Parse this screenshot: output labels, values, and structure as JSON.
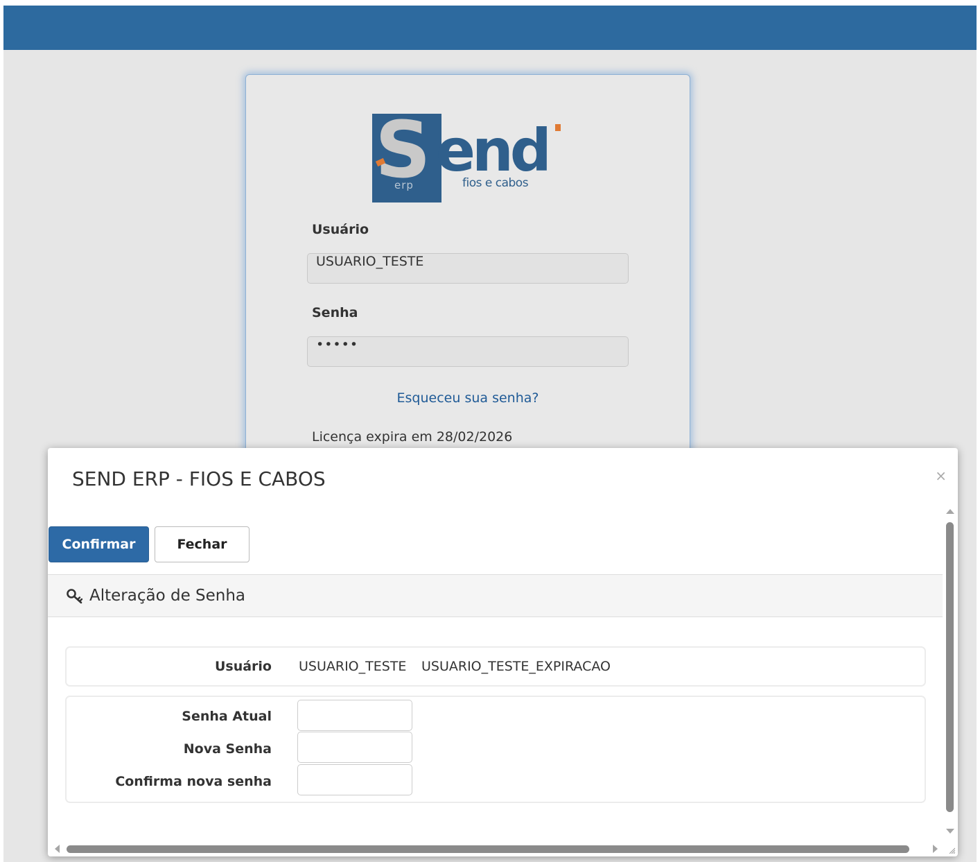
{
  "login": {
    "logo": {
      "s_letter": "S",
      "end_text": "end",
      "erp_text": "erp",
      "subtitle": "fios e cabos"
    },
    "user_label": "Usuário",
    "user_value": "USUARIO_TESTE",
    "password_label": "Senha",
    "password_mask": "•••••",
    "forgot_link": "Esqueceu sua senha?",
    "license_text": "Licença expira em 28/02/2026"
  },
  "modal": {
    "title": "SEND ERP - FIOS E CABOS",
    "close_symbol": "×",
    "buttons": {
      "confirm": "Confirmar",
      "close": "Fechar"
    },
    "panel": {
      "icon": "key-icon",
      "title": "Alteração de Senha",
      "user_label": "Usuário",
      "user_login": "USUARIO_TESTE",
      "user_name": "USUARIO_TESTE_EXPIRACAO",
      "current_password_label": "Senha Atual",
      "new_password_label": "Nova Senha",
      "confirm_password_label": "Confirma nova senha"
    }
  },
  "colors": {
    "topbar": "#2d6a9f",
    "primary_button": "#2d6aa6",
    "link": "#1f5a96",
    "brand_orange": "#e07a34"
  }
}
